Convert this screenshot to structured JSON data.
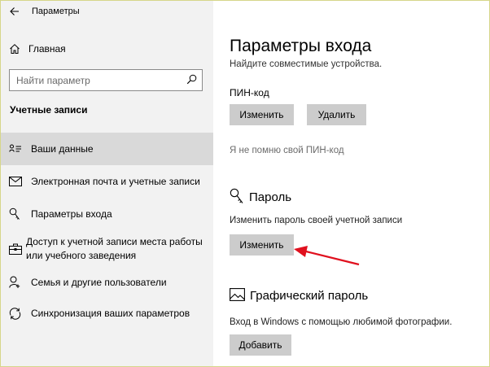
{
  "window": {
    "title": "Параметры"
  },
  "sidebar": {
    "home_label": "Главная",
    "search_placeholder": "Найти параметр",
    "section_title": "Учетные записи",
    "items": [
      {
        "label": "Ваши данные",
        "icon": "person-card-icon",
        "active": true
      },
      {
        "label": "Электронная почта и учетные записи",
        "icon": "mail-icon",
        "active": false
      },
      {
        "label": "Параметры входа",
        "icon": "key-icon",
        "active": false
      },
      {
        "label": "Доступ к учетной записи места работы или учебного заведения",
        "icon": "briefcase-icon",
        "active": false
      },
      {
        "label": "Семья и другие пользователи",
        "icon": "person-add-icon",
        "active": false
      },
      {
        "label": "Синхронизация ваших параметров",
        "icon": "sync-icon",
        "active": false
      }
    ]
  },
  "main": {
    "title": "Параметры входа",
    "subtitle": "Найдите совместимые устройства.",
    "pin": {
      "heading": "ПИН-код",
      "change_label": "Изменить",
      "delete_label": "Удалить",
      "forgot_link": "Я не помню свой ПИН-код"
    },
    "password": {
      "heading": "Пароль",
      "description": "Изменить пароль своей учетной записи",
      "change_label": "Изменить"
    },
    "picture_password": {
      "heading": "Графический пароль",
      "description": "Вход в Windows с помощью любимой фотографии.",
      "add_label": "Добавить"
    }
  },
  "colors": {
    "sidebar_bg": "#f2f2f2",
    "active_item_bg": "#d9d9d9",
    "button_bg": "#cccccc",
    "annotation_arrow": "#e0101e"
  }
}
